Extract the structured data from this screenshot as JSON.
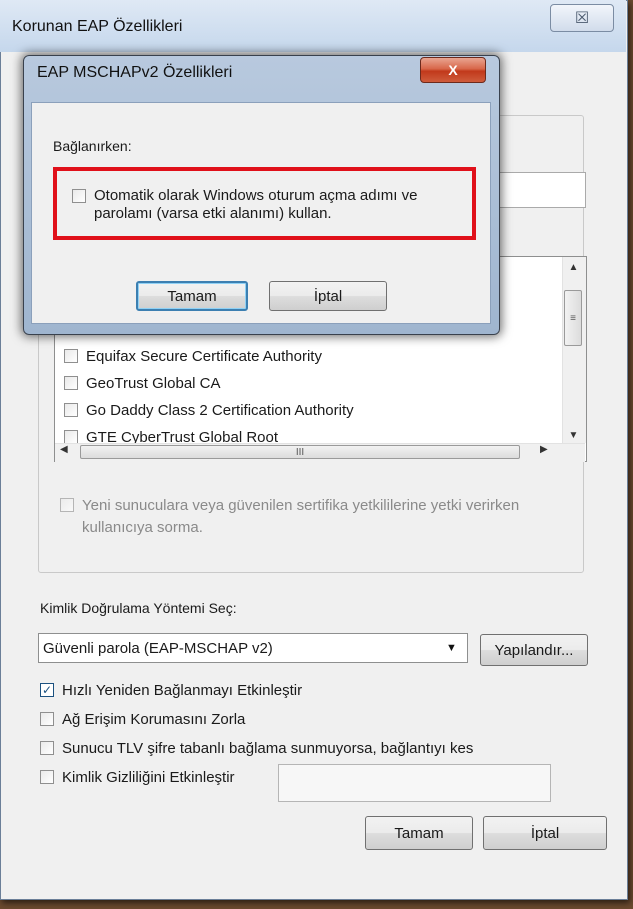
{
  "outer_dialog": {
    "title": "Korunan EAP Özellikleri",
    "close_glyph": "☒",
    "certificates": [
      {
        "label": "Equifax Secure Certificate Authority",
        "checked": false
      },
      {
        "label": "GeoTrust Global CA",
        "checked": false
      },
      {
        "label": "Go Daddy Class 2 Certification Authority",
        "checked": false
      },
      {
        "label": "GTE CyberTrust Global Root",
        "checked": false
      }
    ],
    "scroll_up_glyph": "▲",
    "scroll_down_glyph": "▼",
    "scroll_left_glyph": "◀",
    "scroll_right_glyph": "▶",
    "scroll_grip_v": "≡",
    "scroll_grip_h": "III",
    "no_prompt_label": "Yeni sunuculara veya güvenilen sertifika yetkililerine yetki verirken kullanıcıya sorma.",
    "method_label": "Kimlik Doğrulama Yöntemi Seç:",
    "method_value": "Güvenli parola (EAP-MSCHAP v2)",
    "method_arrow_glyph": "▼",
    "configure_label": "Yapılandır...",
    "options": [
      {
        "label": "Hızlı Yeniden Bağlanmayı Etkinleştir",
        "checked": true
      },
      {
        "label": "Ağ Erişim Korumasını Zorla",
        "checked": false
      },
      {
        "label": "Sunucu TLV şifre tabanlı bağlama sunmuyorsa, bağlantıyı kes",
        "checked": false
      },
      {
        "label": "Kimlik Gizliliğini Etkinleştir",
        "checked": false
      }
    ],
    "check_glyph": "✓",
    "ok_label": "Tamam",
    "cancel_label": "İptal"
  },
  "inner_dialog": {
    "title": "EAP MSCHAPv2 Özellikleri",
    "close_glyph": "X",
    "connecting_label": "Bağlanırken:",
    "auto_logon_label": "Otomatik olarak Windows oturum açma adımı ve parolamı (varsa etki alanımı) kullan.",
    "auto_logon_checked": false,
    "highlight_color": "#e0101a",
    "ok_label": "Tamam",
    "cancel_label": "İptal"
  }
}
